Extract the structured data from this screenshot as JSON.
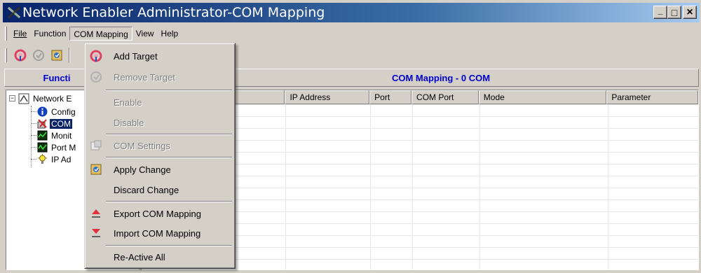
{
  "window": {
    "title": "Network Enabler Administrator-COM Mapping",
    "minimize_label": "_",
    "maximize_label": "□",
    "close_label": "×"
  },
  "menubar": {
    "items": [
      {
        "label": "File"
      },
      {
        "label": "Function"
      },
      {
        "label": "COM Mapping"
      },
      {
        "label": "View"
      },
      {
        "label": "Help"
      }
    ]
  },
  "toolbar": {
    "buttons": [
      "add-target",
      "remove-target",
      "apply-change"
    ]
  },
  "left_panel": {
    "header": "Functi",
    "tree": {
      "root": "Network E",
      "expander": "−",
      "children": [
        {
          "label": "Config",
          "icon": "info-icon"
        },
        {
          "label": "COM",
          "icon": "com-mapping-icon",
          "selected": true
        },
        {
          "label": "Monit",
          "icon": "monitor-icon"
        },
        {
          "label": "Port M",
          "icon": "port-monitor-icon"
        },
        {
          "label": "IP Ad",
          "icon": "ip-address-icon"
        }
      ]
    }
  },
  "right_panel": {
    "header": "COM Mapping - 0 COM",
    "columns": [
      "",
      "IP Address",
      "Port",
      "COM Port",
      "Mode",
      "Parameter"
    ]
  },
  "com_mapping_menu": {
    "items": [
      {
        "label": "Add Target",
        "underline": "A",
        "enabled": true,
        "icon": "add-target-icon"
      },
      {
        "label": "Remove Target",
        "underline": "R",
        "enabled": false,
        "icon": "remove-target-icon"
      },
      {
        "label": "Enable",
        "underline": "E",
        "enabled": false
      },
      {
        "label": "Disable",
        "underline": "D",
        "enabled": false
      },
      {
        "label": "COM Settings",
        "underline": "C",
        "enabled": false,
        "icon": "com-settings-icon"
      },
      {
        "label": "Apply Change",
        "underline": "p",
        "enabled": true,
        "icon": "apply-change-icon"
      },
      {
        "label": "Discard Change",
        "underline": "s",
        "enabled": true
      },
      {
        "label": "Export COM Mapping",
        "underline": "x",
        "enabled": true,
        "icon": "export-icon"
      },
      {
        "label": "Import COM Mapping",
        "underline": "I",
        "enabled": true,
        "icon": "import-icon"
      },
      {
        "label": "Re-Active All",
        "underline": "t",
        "enabled": true
      }
    ]
  },
  "colors": {
    "title_start": "#0a246a",
    "title_end": "#a6caf0",
    "header_text": "#0000d0",
    "selection": "#0a246a",
    "face": "#d4d0c8"
  }
}
